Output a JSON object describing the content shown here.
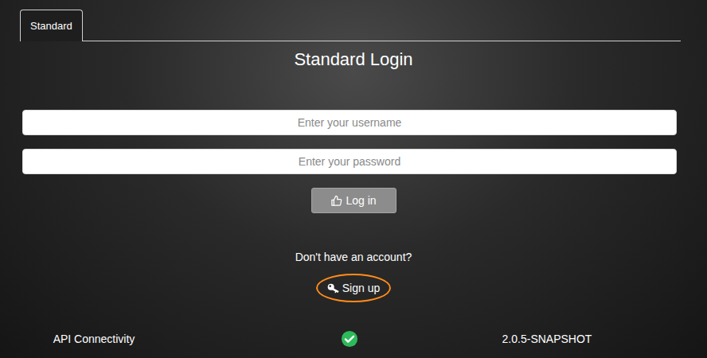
{
  "tabs": [
    {
      "label": "Standard",
      "selected": true
    }
  ],
  "login": {
    "title": "Standard Login",
    "username_placeholder": "Enter your username",
    "password_placeholder": "Enter your password",
    "button": "Log in"
  },
  "signup": {
    "prompt": "Don't have an account?",
    "label": "Sign up",
    "highlighted": true
  },
  "status": {
    "label": "API Connectivity",
    "connected": true,
    "version": "2.0.5-SNAPSHOT"
  }
}
